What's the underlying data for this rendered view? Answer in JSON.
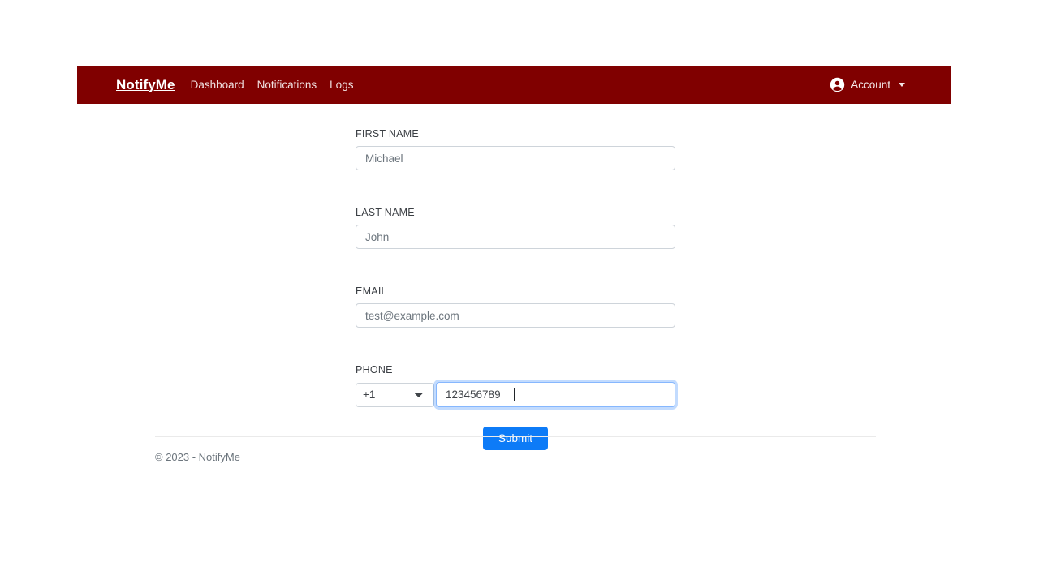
{
  "navbar": {
    "brand": "NotifyMe",
    "links": [
      {
        "label": "Dashboard"
      },
      {
        "label": "Notifications"
      },
      {
        "label": "Logs"
      }
    ],
    "account": {
      "label": "Account",
      "icon": "account-circle-icon",
      "caret": "caret-down-icon"
    },
    "background_color": "#800000"
  },
  "form": {
    "fields": [
      {
        "label": "FIRST NAME",
        "value": "",
        "placeholder": "Michael",
        "name": "first-name"
      },
      {
        "label": "LAST NAME",
        "value": "",
        "placeholder": "John",
        "name": "last-name"
      },
      {
        "label": "EMAIL",
        "value": "",
        "placeholder": "test@example.com",
        "name": "email"
      }
    ],
    "phone": {
      "label": "PHONE",
      "country_code_selected": "+1",
      "country_code_options": [
        "+1"
      ],
      "value": "123456789",
      "focused": true
    },
    "submit_label": "Submit",
    "submit_color": "#0d7bf7"
  },
  "footer": {
    "copyright": "© 2023 - NotifyMe"
  }
}
